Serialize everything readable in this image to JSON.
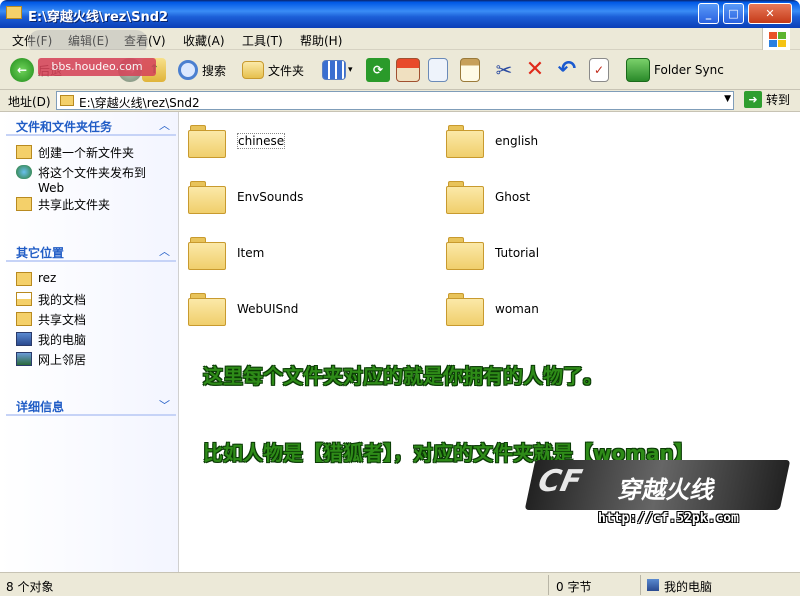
{
  "window": {
    "title": "E:\\穿越火线\\rez\\Snd2",
    "min": "_",
    "max": "□",
    "close": "✕"
  },
  "menu": [
    {
      "label": "文件(F)"
    },
    {
      "label": "编辑(E)"
    },
    {
      "label": "查看(V)"
    },
    {
      "label": "收藏(A)"
    },
    {
      "label": "工具(T)"
    },
    {
      "label": "帮助(H)"
    }
  ],
  "toolbar": {
    "back": "后退",
    "search": "搜索",
    "folders": "文件夹",
    "folder_sync": "Folder Sync"
  },
  "address": {
    "label": "地址(D)",
    "value": "E:\\穿越火线\\rez\\Snd2",
    "go": "转到"
  },
  "tasks": {
    "title": "文件和文件夹任务",
    "items": [
      {
        "label": "创建一个新文件夹"
      },
      {
        "label": "将这个文件夹发布到 Web"
      },
      {
        "label": "共享此文件夹"
      }
    ]
  },
  "places": {
    "title": "其它位置",
    "items": [
      {
        "label": "rez"
      },
      {
        "label": "我的文档"
      },
      {
        "label": "共享文档"
      },
      {
        "label": "我的电脑"
      },
      {
        "label": "网上邻居"
      }
    ]
  },
  "details": {
    "title": "详细信息"
  },
  "folders": [
    {
      "name": "chinese"
    },
    {
      "name": "english"
    },
    {
      "name": "EnvSounds"
    },
    {
      "name": "Ghost"
    },
    {
      "name": "Item"
    },
    {
      "name": "Tutorial"
    },
    {
      "name": "WebUISnd"
    },
    {
      "name": "woman"
    }
  ],
  "annotations": {
    "line1": "这里每个文件夹对应的就是你拥有的人物了。",
    "line2": "比如人物是【猎狐者】，对应的文件夹就是【woman】"
  },
  "logo": {
    "cf": "CF",
    "name": "穿越火线",
    "url": "http://cf.52pk.com"
  },
  "watermark": "bbs.houdeo.com",
  "status": {
    "count": "8 个对象",
    "size": "0 字节",
    "location": "我的电脑"
  },
  "colors": {
    "title_blue": "#0058e6",
    "task_blue": "#215dc6",
    "annotation_green": "#2e8b18"
  }
}
